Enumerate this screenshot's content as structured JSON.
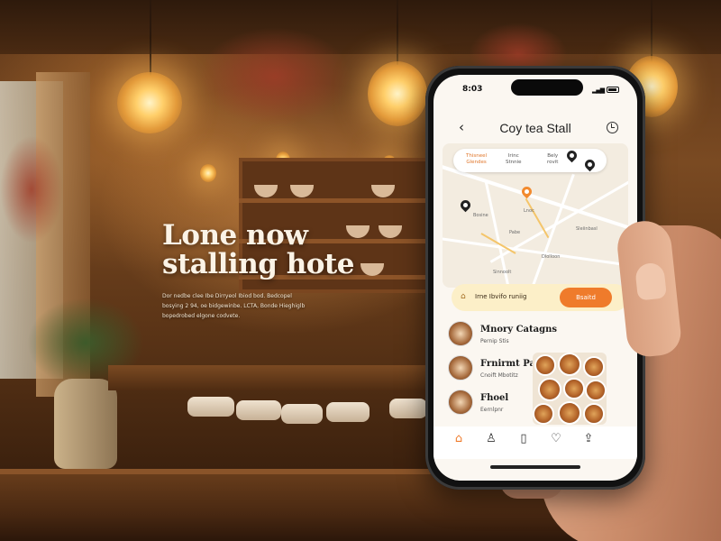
{
  "headline": {
    "line1": "Lone now",
    "line2": "stalling hote",
    "sub_line1": "Dor nedbe clee Ibe Dirryeol Ibiod bod. Bedcopel",
    "sub_line2": "bosying 2 94, oe bidgewinbe. LCTA, Bonde Hieghiglb",
    "sub_line3": "bopedrobed elgone codvete."
  },
  "app": {
    "status_time": "8:03",
    "title": "Coy tea Stall",
    "back_icon": "chevron-left-icon",
    "history_icon": "clock-icon",
    "chips": [
      {
        "label": "Thisneel\nGlendes"
      },
      {
        "label": "Irinc\nStnnie"
      },
      {
        "label": "Bely\nrovit"
      }
    ],
    "map_labels": [
      "Bosine",
      "Lnoc",
      "Sleiinbasl",
      "Pabe",
      "Dlolloon",
      "Sinnoolt"
    ],
    "banner": {
      "text": "Irne Ibvifo runiig",
      "button": "Bsaitd"
    },
    "list": [
      {
        "title": "Mnory Catagns",
        "sub": "Pernip Stis"
      },
      {
        "title": "Frnirmt Pall",
        "sub": "Cnoift Mbotitz"
      },
      {
        "title": "Fhoel",
        "sub": "Eernlpnr"
      }
    ],
    "nav": [
      "home-icon",
      "user-icon",
      "bookmark-icon",
      "heart-icon",
      "share-icon"
    ],
    "accent_color": "#ef7b2b"
  }
}
